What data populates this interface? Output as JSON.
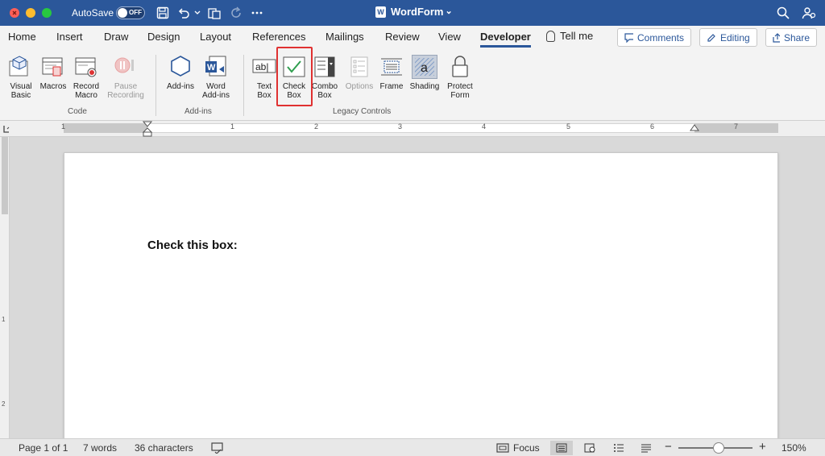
{
  "titlebar": {
    "autosave_label": "AutoSave",
    "autosave_state": "OFF",
    "doc_title": "WordForm",
    "doc_title_chevron": "⌄",
    "word_icon_letter": "W"
  },
  "tabs": [
    {
      "label": "Home"
    },
    {
      "label": "Insert"
    },
    {
      "label": "Draw"
    },
    {
      "label": "Design"
    },
    {
      "label": "Layout"
    },
    {
      "label": "References"
    },
    {
      "label": "Mailings"
    },
    {
      "label": "Review"
    },
    {
      "label": "View"
    },
    {
      "label": "Developer"
    }
  ],
  "tell_me": "Tell me",
  "ribbon_buttons": {
    "comments": "Comments",
    "editing": "Editing",
    "share": "Share"
  },
  "groups": {
    "code": {
      "label": "Code",
      "commands": {
        "visual_basic": [
          "Visual",
          "Basic"
        ],
        "macros": "Macros",
        "record_macro": [
          "Record",
          "Macro"
        ],
        "pause_recording": [
          "Pause",
          "Recording"
        ]
      }
    },
    "addins": {
      "label": "Add-ins",
      "commands": {
        "addins": "Add-ins",
        "word_addins": [
          "Word",
          "Add-ins"
        ]
      }
    },
    "legacy": {
      "label": "Legacy Controls",
      "commands": {
        "text_box": [
          "Text",
          "Box"
        ],
        "check_box": [
          "Check",
          "Box"
        ],
        "combo_box": [
          "Combo",
          "Box"
        ],
        "options": "Options",
        "frame": "Frame",
        "shading": "Shading",
        "protect_form": [
          "Protect",
          "Form"
        ]
      },
      "text_box_icon": "ab|",
      "shading_icon": "a"
    }
  },
  "ruler": {
    "numbers": [
      "1",
      "1",
      "2",
      "3",
      "4",
      "5",
      "6",
      "7"
    ]
  },
  "vertical_ruler": {
    "numbers": [
      "1",
      "2"
    ]
  },
  "document": {
    "text": "Check this box:"
  },
  "status": {
    "page": "Page 1 of 1",
    "words": "7 words",
    "characters": "36 characters",
    "focus": "Focus",
    "zoom": "150%",
    "zoom_minus": "−",
    "zoom_plus": "+",
    "zoom_level": 0.55
  },
  "colors": {
    "brand": "#2b579a",
    "highlight": "#e03131"
  }
}
